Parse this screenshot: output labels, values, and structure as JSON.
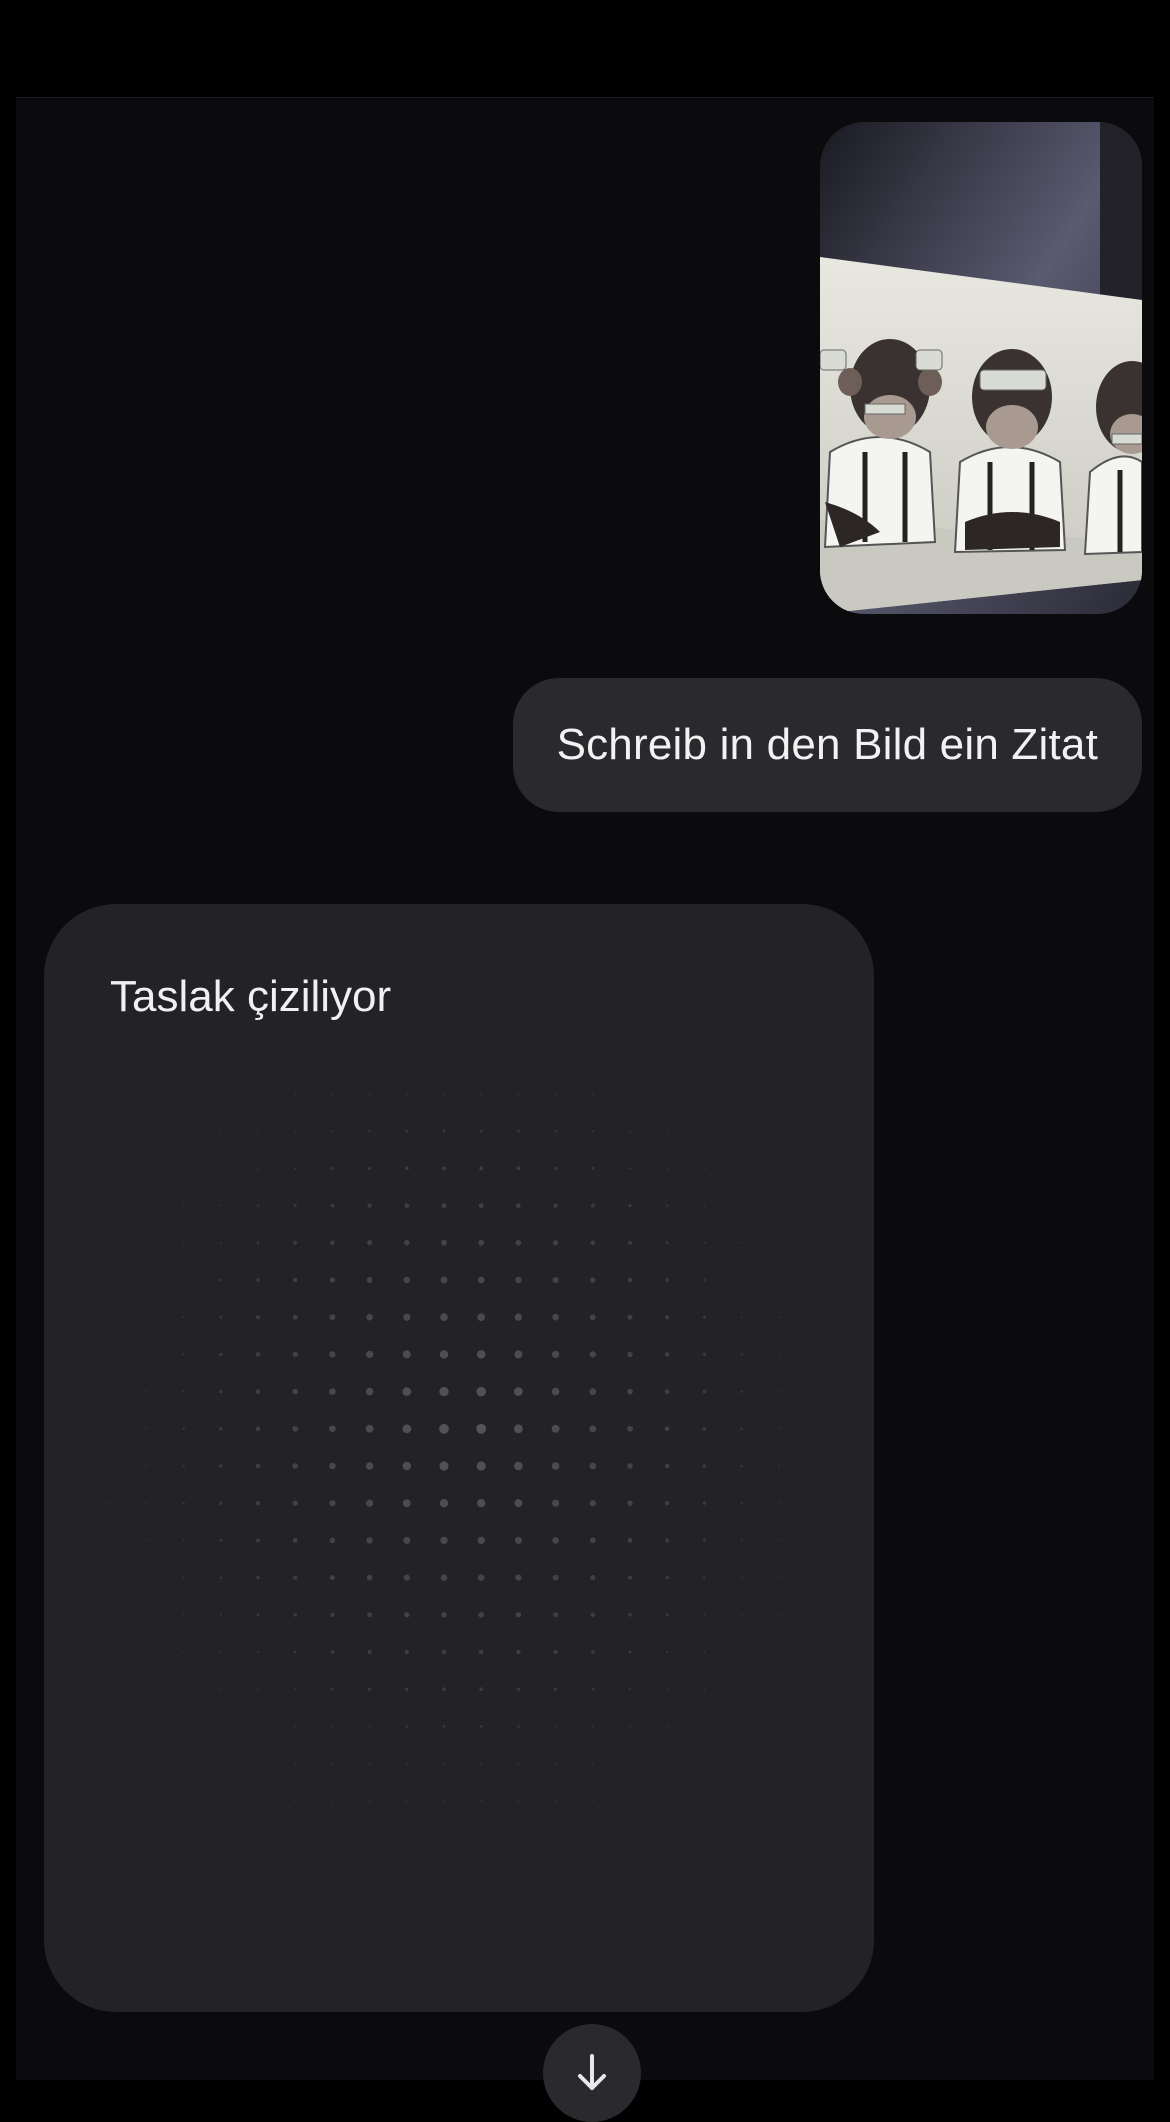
{
  "conversation": {
    "user_image": {
      "description_icon": "image-icon",
      "depicts": "three-monkeys-artwork"
    },
    "user_message": "Schreib in den Bild ein Zitat",
    "assistant_status": {
      "label": "Taslak çiziliyor"
    },
    "scroll_button": {
      "icon": "arrow-down-icon"
    }
  },
  "colors": {
    "background": "#000000",
    "chat_background": "#0b0b0d",
    "bubble": "#2a2a2e",
    "card": "#232327",
    "text": "#f0f0f0"
  }
}
